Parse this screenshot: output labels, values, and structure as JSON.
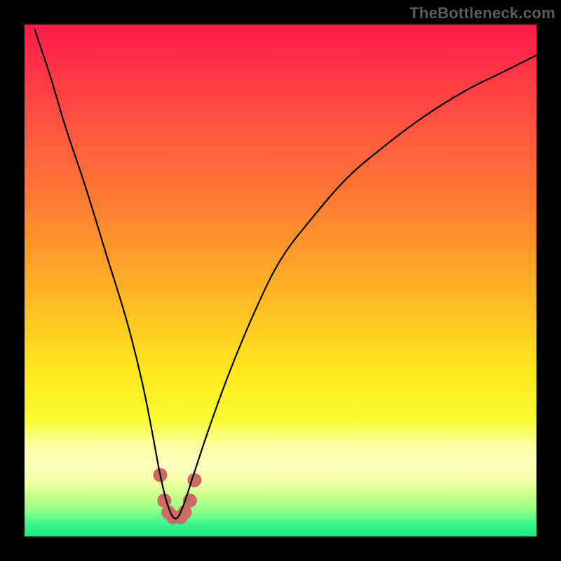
{
  "watermark": {
    "text": "TheBottleneck.com"
  },
  "colors": {
    "frame": "#000000",
    "curve": "#000000",
    "marker": "#cb6a67",
    "watermark": "#5c5c5c"
  },
  "gradient_stops": [
    {
      "offset": 0.0,
      "color": "#ff1b4b"
    },
    {
      "offset": 0.1,
      "color": "#ff3847"
    },
    {
      "offset": 0.22,
      "color": "#ff5b3f"
    },
    {
      "offset": 0.34,
      "color": "#ff7a34"
    },
    {
      "offset": 0.46,
      "color": "#ff9f2a"
    },
    {
      "offset": 0.58,
      "color": "#ffc722"
    },
    {
      "offset": 0.68,
      "color": "#ffe81d"
    },
    {
      "offset": 0.77,
      "color": "#f8fb30"
    },
    {
      "offset": 0.82,
      "color": "#fdff9f"
    },
    {
      "offset": 0.86,
      "color": "#fbffbd"
    },
    {
      "offset": 0.89,
      "color": "#f4ffa8"
    },
    {
      "offset": 0.92,
      "color": "#caff88"
    },
    {
      "offset": 0.95,
      "color": "#90ff87"
    },
    {
      "offset": 0.975,
      "color": "#3df58b"
    },
    {
      "offset": 1.0,
      "color": "#18ec83"
    }
  ],
  "chart_data": {
    "type": "line",
    "title": "",
    "xlabel": "",
    "ylabel": "",
    "ylim": [
      0,
      100
    ],
    "xlim": [
      0,
      100
    ],
    "series": [
      {
        "name": "bottleneck-curve",
        "x": [
          2,
          5,
          8,
          12,
          16,
          20,
          23,
          25,
          26.5,
          28,
          29.5,
          31,
          33,
          36,
          40,
          45,
          50,
          56,
          63,
          70,
          78,
          86,
          94,
          100
        ],
        "y": [
          99,
          90,
          80,
          68,
          55,
          42,
          30,
          20,
          12,
          6,
          3.5,
          6,
          12,
          21,
          32,
          44,
          54,
          62,
          70,
          76,
          82,
          87,
          91,
          94
        ]
      }
    ],
    "markers": {
      "name": "bottom-cluster",
      "x": [
        26.5,
        27.3,
        28.1,
        29.0,
        30.5,
        31.3,
        32.3,
        33.2
      ],
      "y": [
        12.0,
        7.0,
        4.7,
        3.8,
        3.8,
        4.7,
        7.0,
        11.0
      ],
      "radius": 10
    }
  }
}
